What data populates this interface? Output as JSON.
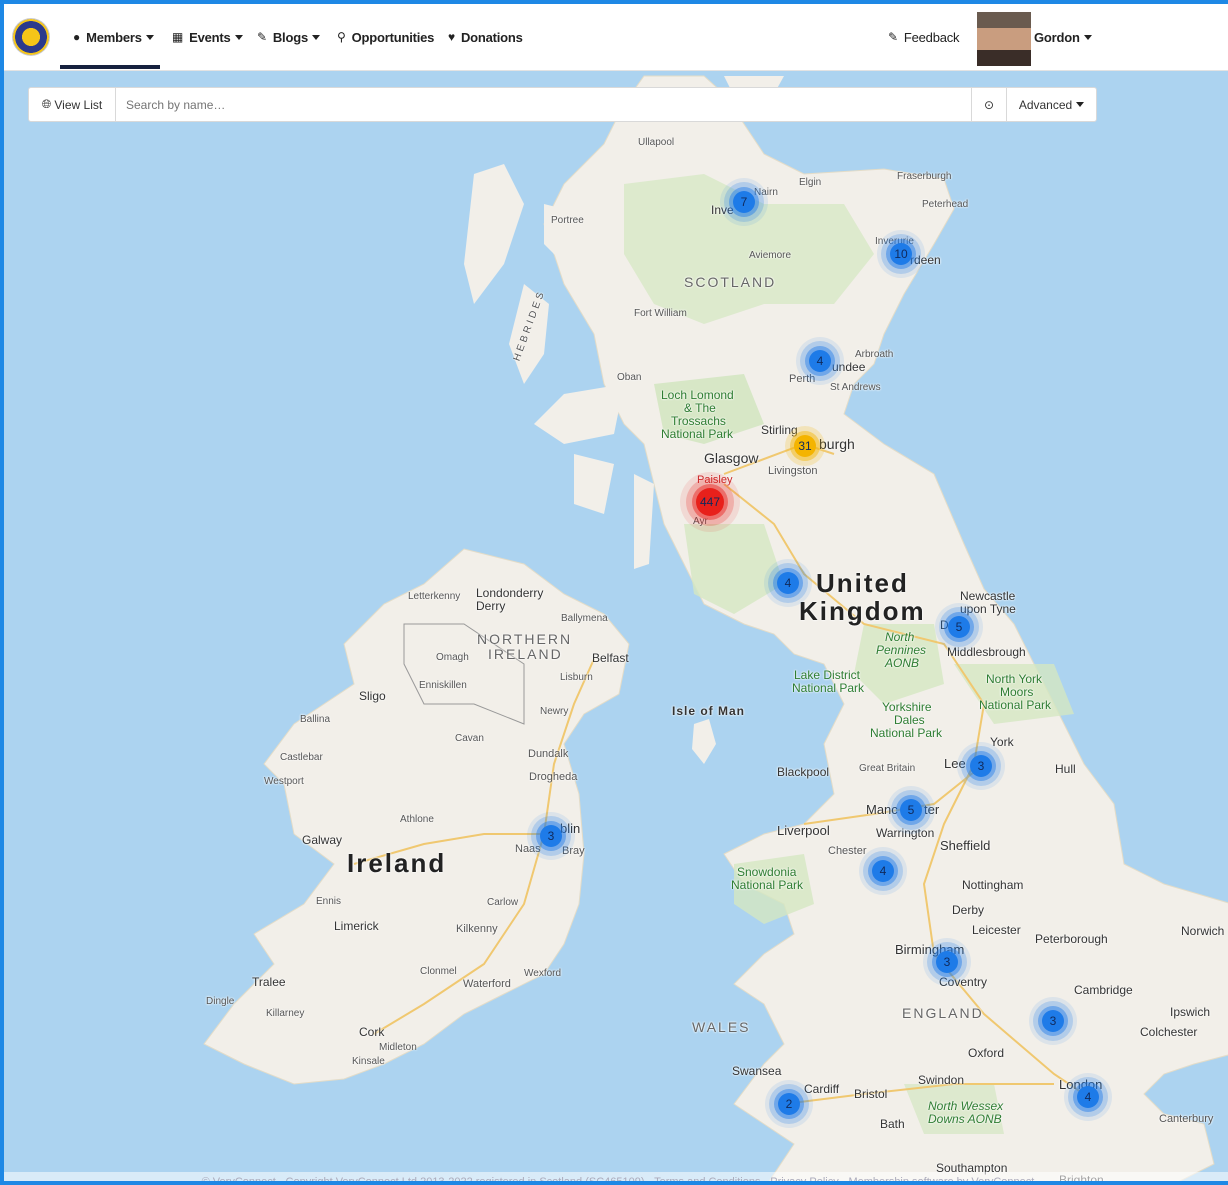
{
  "nav": {
    "items": [
      {
        "label": "Members",
        "icon": "user-icon",
        "caret": true
      },
      {
        "label": "Events",
        "icon": "calendar-icon",
        "caret": true
      },
      {
        "label": "Blogs",
        "icon": "pencil-icon",
        "caret": true
      },
      {
        "label": "Opportunities",
        "icon": "lightbulb-icon",
        "caret": false
      },
      {
        "label": "Donations",
        "icon": "heart-icon",
        "caret": false
      }
    ],
    "feedback_label": "Feedback",
    "user_name": "Gordon"
  },
  "search": {
    "view_list_label": "View List",
    "placeholder": "Search by name…",
    "advanced_label": "Advanced"
  },
  "map_labels": {
    "scotland": "SCOTLAND",
    "united": "United",
    "kingdom": "Kingdom",
    "ireland": "Ireland",
    "northern_ireland_1": "NORTHERN",
    "northern_ireland_2": "IRELAND",
    "wales": "WALES",
    "england": "ENGLAND",
    "isle_of_man": "Isle of Man",
    "hebrides": "HEBRIDES",
    "glasgow": "Glasgow",
    "edinburgh": "burgh",
    "paisley": "Paisley",
    "livingston": "Livingston",
    "stirling": "Stirling",
    "perth": "Perth",
    "st_andrews": "St Andrews",
    "arbroath": "Arbroath",
    "dundee": "undee",
    "aberdeen": "rdeen",
    "inverurie": "Inverurie",
    "peterhead": "Peterhead",
    "fraserburgh": "Fraserburgh",
    "elgin": "Elgin",
    "nairn": "Nairn",
    "inverness": "Inve",
    "aviemore": "Aviemore",
    "fort_william": "Fort William",
    "oban": "Oban",
    "portree": "Portree",
    "ullapool": "Ullapool",
    "loch_lomond": "Loch Lomond",
    "loch_lomond_2": "& The",
    "loch_lomond_3": "Trossachs",
    "loch_lomond_4": "National Park",
    "ayr": "Ayr",
    "newcastle": "Newcastle",
    "newcastle_2": "upon Tyne",
    "durham": "D",
    "middlesbrough": "Middlesbrough",
    "north_pennines": "North",
    "north_pennines_2": "Pennines",
    "north_pennines_3": "AONB",
    "lake_district": "Lake District",
    "lake_district_2": "National Park",
    "north_york": "North York",
    "north_york_2": "Moors",
    "north_york_3": "National Park",
    "yorkshire_dales": "Yorkshire",
    "yorkshire_dales_2": "Dales",
    "yorkshire_dales_3": "National Park",
    "york": "York",
    "leeds": "Lee",
    "hull": "Hull",
    "blackpool": "Blackpool",
    "great_britain": "Great Britain",
    "manchester": "Manc",
    "manchester_2": "ter",
    "liverpool": "Liverpool",
    "warrington": "Warrington",
    "sheffield": "Sheffield",
    "chester": "Chester",
    "snowdonia": "Snowdonia",
    "snowdonia_2": "National Park",
    "nottingham": "Nottingham",
    "derby": "Derby",
    "leicester": "Leicester",
    "peterborough": "Peterborough",
    "norwich": "Norwich",
    "birmingham": "Birmingham",
    "coventry": "Coventry",
    "cambridge": "Cambridge",
    "ipswich": "Ipswich",
    "colchester": "Colchester",
    "oxford": "Oxford",
    "swindon": "Swindon",
    "london": "London",
    "swansea": "Swansea",
    "cardiff": "Cardiff",
    "bristol": "Bristol",
    "bath": "Bath",
    "north_wessex": "North Wessex",
    "north_wessex_2": "Downs AONB",
    "canterbury": "Canterbury",
    "southampton": "Southampton",
    "brighton": "Brighton",
    "londonderry": "Londonderry",
    "derry": "Derry",
    "letterkenny": "Letterkenny",
    "ballymena": "Ballymena",
    "belfast": "Belfast",
    "lisburn": "Lisburn",
    "omagh": "Omagh",
    "enniskillen": "Enniskillen",
    "sligo": "Sligo",
    "ballina": "Ballina",
    "castlebar": "Castlebar",
    "westport": "Westport",
    "newry": "Newry",
    "cavan": "Cavan",
    "dundalk": "Dundalk",
    "drogheda": "Drogheda",
    "athlone": "Athlone",
    "galway": "Galway",
    "dublin": "blin",
    "naas": "Naas",
    "bray": "Bray",
    "ennis": "Ennis",
    "limerick": "Limerick",
    "carlow": "Carlow",
    "kilkenny": "Kilkenny",
    "clonmel": "Clonmel",
    "wexford": "Wexford",
    "waterford": "Waterford",
    "tralee": "Tralee",
    "dingle": "Dingle",
    "killarney": "Killarney",
    "cork": "Cork",
    "midleton": "Midleton",
    "kinsale": "Kinsale"
  },
  "clusters": [
    {
      "id": "inverness",
      "count": "7",
      "color": "blue"
    },
    {
      "id": "aberdeen",
      "count": "10",
      "color": "blue"
    },
    {
      "id": "dundee",
      "count": "4",
      "color": "blue"
    },
    {
      "id": "edinburgh",
      "count": "31",
      "color": "orange"
    },
    {
      "id": "ayrshire",
      "count": "447",
      "color": "red"
    },
    {
      "id": "dumfries",
      "count": "4",
      "color": "blue"
    },
    {
      "id": "durham",
      "count": "5",
      "color": "blue"
    },
    {
      "id": "leeds",
      "count": "3",
      "color": "blue"
    },
    {
      "id": "manchester",
      "count": "5",
      "color": "blue"
    },
    {
      "id": "stoke",
      "count": "4",
      "color": "blue"
    },
    {
      "id": "birmingham",
      "count": "3",
      "color": "blue"
    },
    {
      "id": "dublin",
      "count": "3",
      "color": "blue"
    },
    {
      "id": "essex",
      "count": "3",
      "color": "blue"
    },
    {
      "id": "london",
      "count": "4",
      "color": "blue"
    },
    {
      "id": "swansea",
      "count": "2",
      "color": "blue"
    }
  ],
  "footer_text": "© VeryConnect · Copyright VeryConnect Ltd 2013-2022 registered in Scotland (SC465109) · Terms and Conditions · Privacy Policy · Membership software by VeryConnect",
  "colors": {
    "accent": "#1e88e5",
    "water": "#acd3f0",
    "land": "#f2efe9",
    "cluster_blue": "#1e7be8",
    "cluster_orange": "#f4b400",
    "cluster_red": "#e8201b"
  }
}
